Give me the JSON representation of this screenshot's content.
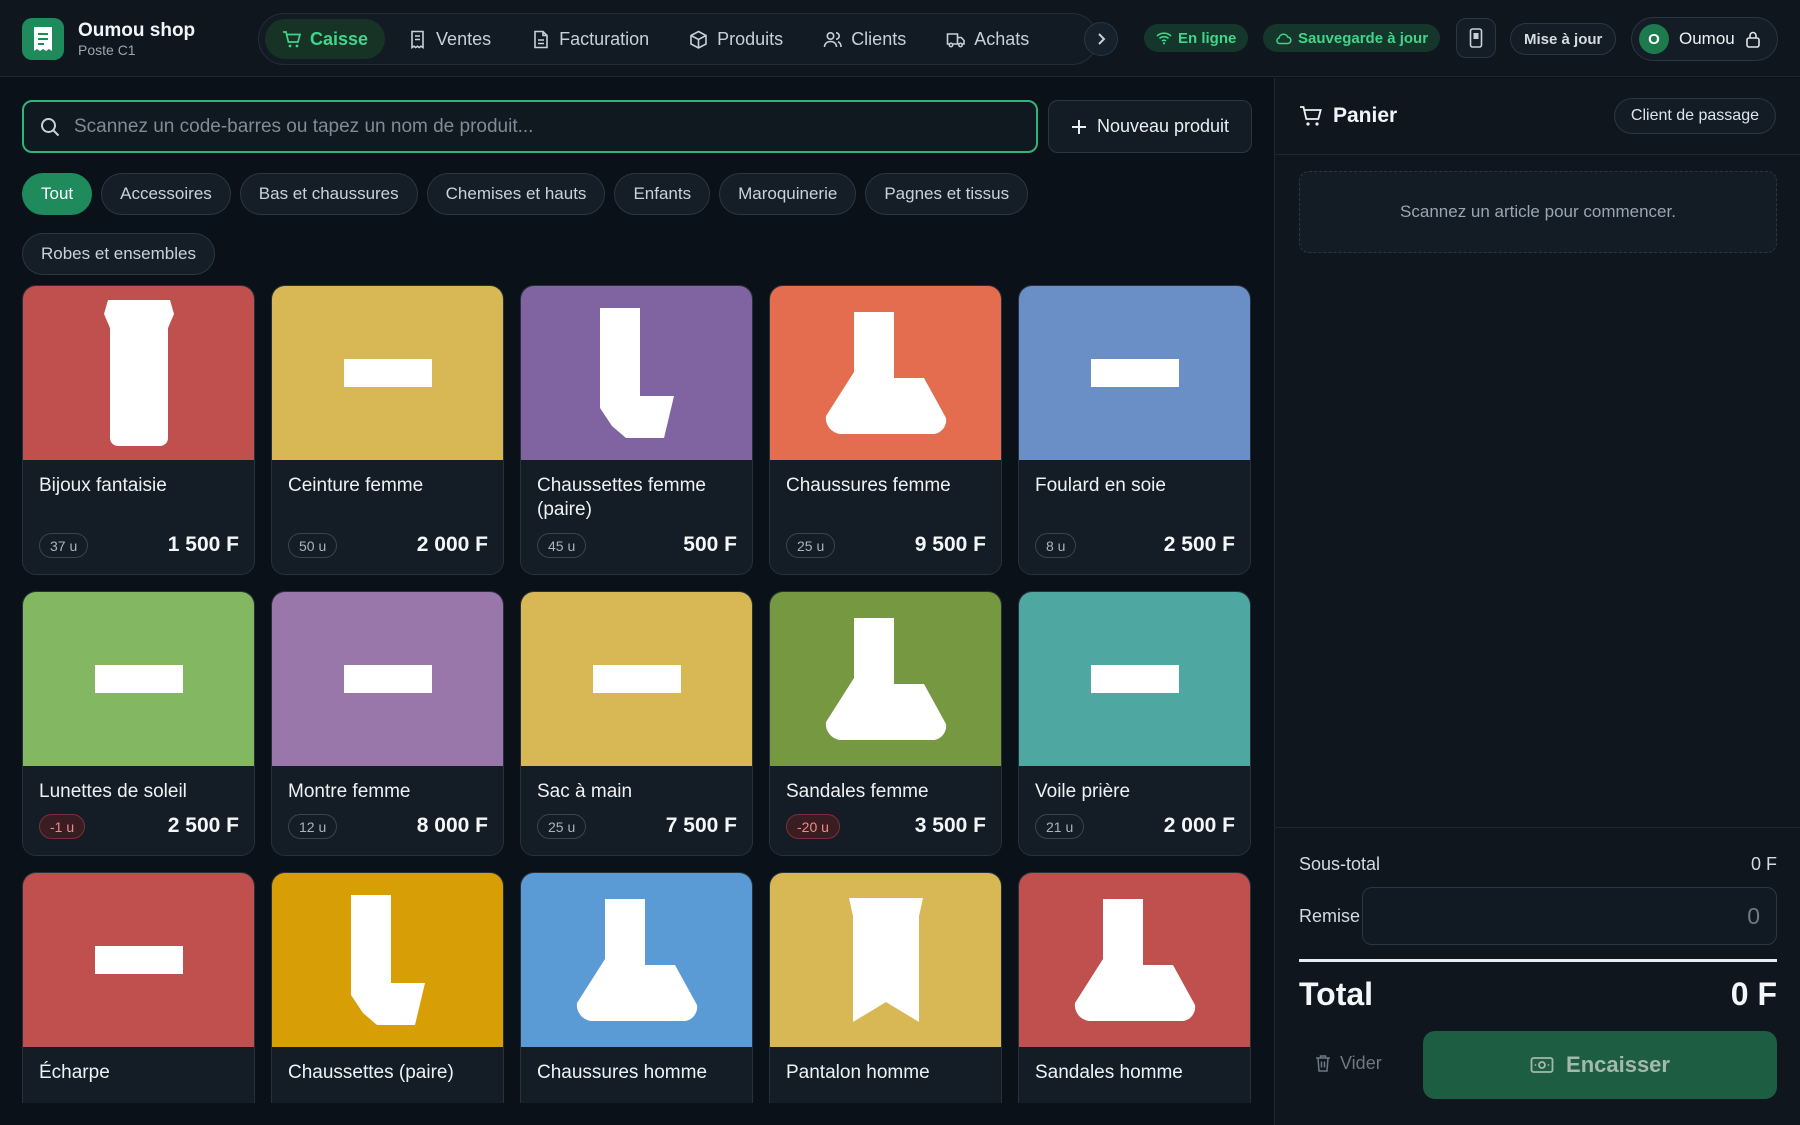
{
  "brand": {
    "name": "Oumou shop",
    "station": "Poste C1"
  },
  "nav": {
    "tabs": [
      {
        "label": "Caisse",
        "icon": "cart-icon",
        "active": true
      },
      {
        "label": "Ventes",
        "icon": "receipt-icon"
      },
      {
        "label": "Facturation",
        "icon": "document-icon"
      },
      {
        "label": "Produits",
        "icon": "box-icon"
      },
      {
        "label": "Clients",
        "icon": "users-icon"
      },
      {
        "label": "Achats",
        "icon": "truck-icon"
      }
    ]
  },
  "status": {
    "online": "En ligne",
    "backup": "Sauvegarde à jour"
  },
  "header": {
    "update_label": "Mise à jour",
    "user_name": "Oumou",
    "user_initial": "O"
  },
  "search": {
    "placeholder": "Scannez un code-barres ou tapez un nom de produit...",
    "value": ""
  },
  "new_product_label": "Nouveau produit",
  "categories": [
    "Tout",
    "Accessoires",
    "Bas et chaussures",
    "Chemises et hauts",
    "Enfants",
    "Maroquinerie",
    "Pagnes et tissus",
    "Robes et ensembles"
  ],
  "active_category": "Tout",
  "products": [
    {
      "name": "Bijoux fantaisie",
      "stock": "37 u",
      "price": "1 500 F",
      "color": "#c0504d",
      "shape": "jar"
    },
    {
      "name": "Ceinture femme",
      "stock": "50 u",
      "price": "2 000 F",
      "color": "#d8b854",
      "shape": "bar"
    },
    {
      "name": "Chaussettes femme (paire)",
      "stock": "45 u",
      "price": "500 F",
      "color": "#8064a2",
      "shape": "sock"
    },
    {
      "name": "Chaussures femme",
      "stock": "25 u",
      "price": "9 500 F",
      "color": "#e46c4f",
      "shape": "boot"
    },
    {
      "name": "Foulard en soie",
      "stock": "8 u",
      "price": "2 500 F",
      "color": "#6a8fc6",
      "shape": "bar"
    },
    {
      "name": "Lunettes de soleil",
      "stock": "-1 u",
      "price": "2 500 F",
      "color": "#84b762",
      "shape": "bar",
      "negative": true
    },
    {
      "name": "Montre femme",
      "stock": "12 u",
      "price": "8 000 F",
      "color": "#9a77ab",
      "shape": "bar"
    },
    {
      "name": "Sac à main",
      "stock": "25 u",
      "price": "7 500 F",
      "color": "#d8b854",
      "shape": "bar"
    },
    {
      "name": "Sandales femme",
      "stock": "-20 u",
      "price": "3 500 F",
      "color": "#769841",
      "shape": "boot",
      "negative": true
    },
    {
      "name": "Voile prière",
      "stock": "21 u",
      "price": "2 000 F",
      "color": "#4ea7a0",
      "shape": "bar"
    },
    {
      "name": "Écharpe",
      "stock": "",
      "price": "",
      "color": "#c0504d",
      "shape": "bar"
    },
    {
      "name": "Chaussettes (paire)",
      "stock": "",
      "price": "",
      "color": "#d89e06",
      "shape": "sock"
    },
    {
      "name": "Chaussures homme",
      "stock": "",
      "price": "",
      "color": "#5b9bd5",
      "shape": "boot"
    },
    {
      "name": "Pantalon homme",
      "stock": "",
      "price": "",
      "color": "#d8b854",
      "shape": "pants"
    },
    {
      "name": "Sandales homme",
      "stock": "",
      "price": "",
      "color": "#c0504d",
      "shape": "boot"
    }
  ],
  "cart": {
    "title": "Panier",
    "customer_label": "Client de passage",
    "empty_message": "Scannez un article pour commencer.",
    "subtotal_label": "Sous-total",
    "subtotal_value": "0 F",
    "discount_label": "Remise",
    "discount_placeholder": "0",
    "total_label": "Total",
    "total_value": "0 F",
    "clear_label": "Vider",
    "checkout_label": "Encaisser"
  }
}
